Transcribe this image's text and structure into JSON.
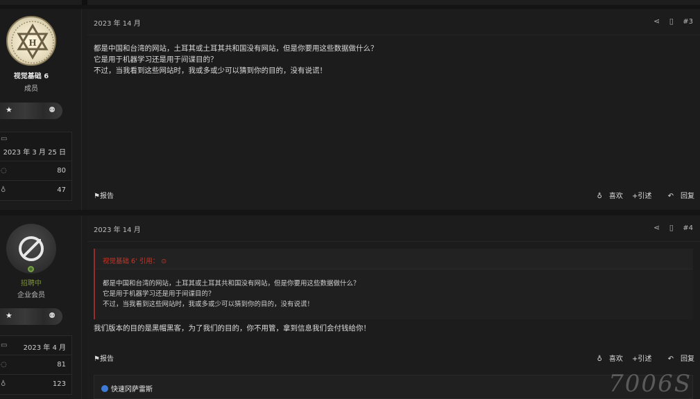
{
  "posts": [
    {
      "user": {
        "name": "视觉基础 6",
        "role": "成员",
        "joined": "2023 年 3 月 25 日",
        "messages": "80",
        "reactions": "47"
      },
      "date": "2023 年 14 月",
      "number": "#3",
      "body": [
        "都是中国和台湾的网站，土耳其或土耳其共和国没有网站，但是你要用这些数据做什么？",
        "它是用于机器学习还是用于间谍目的？",
        "不过，当我看到这些网站时，我或多或少可以猜到你的目的，没有说谎！"
      ],
      "footer": {
        "report": "报告",
        "like": "喜欢",
        "quote": "+引述",
        "reply": "回复"
      }
    },
    {
      "user": {
        "status": "招聘中",
        "role": "企业会员",
        "joined": "2023 年 4 月",
        "messages": "81",
        "reactions": "123"
      },
      "date": "2023 年 14 月",
      "number": "#4",
      "quote": {
        "header": "视觉基础 6' 引用：",
        "lines": [
          "都是中国和台湾的网站，土耳其或土耳其共和国没有网站，但是你要用这些数据做什么？",
          "它是用于机器学习还是用于间谍目的？",
          "不过，当我看到这些网站时，我或多或少可以猜到你的目的，没有说谎！"
        ]
      },
      "body": [
        "我们版本的目的是黑帽黑客，为了我们的目的，你不用管，拿到信息我们会付钱给你！"
      ],
      "footer": {
        "report": "报告",
        "like": "喜欢",
        "quote": "+引述",
        "reply": "回复"
      },
      "quickbar": "快速冈萨雷斯"
    }
  ],
  "watermark": "7006S",
  "icons": {
    "share": "share-icon",
    "bookmark": "bookmark-icon",
    "calendar": "calendar-icon",
    "messages": "messages-icon",
    "reactions": "thumbs-up-icon",
    "report": "flag-icon",
    "like": "thumbs-up-icon",
    "reply": "reply-icon"
  }
}
